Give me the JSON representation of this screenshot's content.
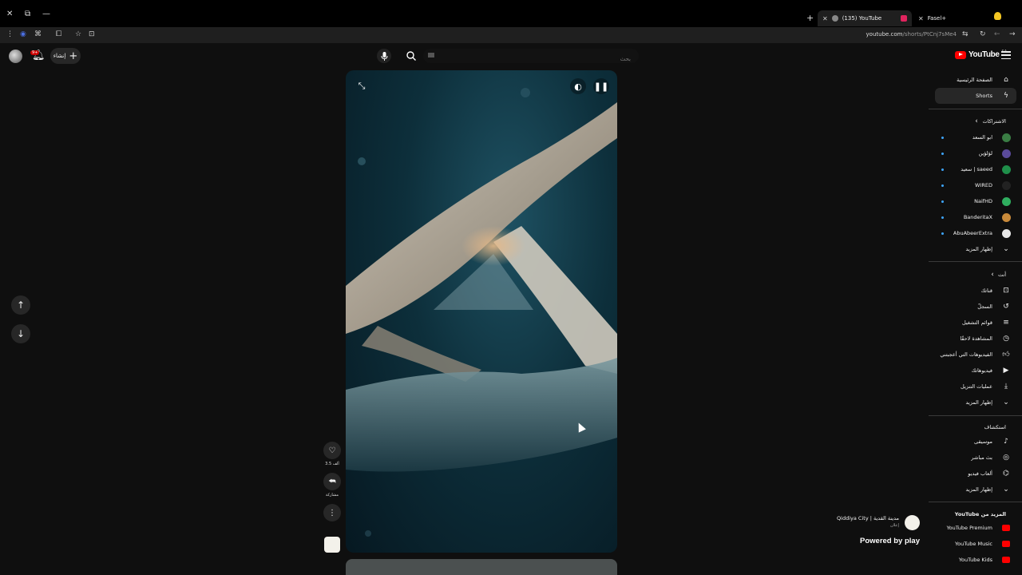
{
  "browser": {
    "tabs": [
      {
        "title": "(135) YouTube",
        "active": true
      },
      {
        "title": "Fasel+",
        "active": false
      }
    ],
    "url_host": "youtube.com",
    "url_path": "/shorts/PtCnj7sMe4"
  },
  "masthead": {
    "logo_text": "YouTube",
    "country_code": "SA",
    "search_placeholder": "بحث",
    "create_label": "إنشاء",
    "notification_count": "9+"
  },
  "short": {
    "likes_label": "3.5 ألف",
    "share_label": "مشاركة"
  },
  "sidebar": {
    "main": [
      {
        "label": "الصفحة الرئيسية",
        "icon": "home-icon"
      },
      {
        "label": "Shorts",
        "icon": "shorts-icon",
        "active": true
      }
    ],
    "subscriptions_title": "الاشتراكات",
    "subscriptions": [
      {
        "label": "ابو السعد",
        "color": "#3a7d44"
      },
      {
        "label": "لؤلؤين",
        "color": "#5a4a9a"
      },
      {
        "label": "saeed | سعيد",
        "color": "#1f8f4a"
      },
      {
        "label": "WIRED",
        "color": "#222222"
      },
      {
        "label": "NaifHD",
        "color": "#2fae5f"
      },
      {
        "label": "BanderitaX",
        "color": "#c98a3a"
      },
      {
        "label": "AbuAbeerExtra",
        "color": "#e8e8e8"
      }
    ],
    "subscriptions_more": "إظهار المزيد",
    "you_title": "أنت",
    "you": [
      {
        "label": "قناتك",
        "icon": "your-channel-icon"
      },
      {
        "label": "السجلّ",
        "icon": "history-icon"
      },
      {
        "label": "قوائم التشغيل",
        "icon": "playlists-icon"
      },
      {
        "label": "المشاهدة لاحقًا",
        "icon": "watch-later-icon"
      },
      {
        "label": "الفيديوهات التي أعجبتني",
        "icon": "liked-videos-icon"
      },
      {
        "label": "فيديوهاتك",
        "icon": "your-videos-icon"
      },
      {
        "label": "عمليات التنزيل",
        "icon": "downloads-icon"
      },
      {
        "label": "إظهار المزيد",
        "icon": "chevron-down-icon"
      }
    ],
    "explore_title": "استكشاف",
    "explore": [
      {
        "label": "موسيقى",
        "icon": "music-icon"
      },
      {
        "label": "بث مباشر",
        "icon": "live-icon"
      },
      {
        "label": "ألعاب فيديو",
        "icon": "gaming-icon"
      },
      {
        "label": "إظهار المزيد",
        "icon": "chevron-down-icon"
      }
    ],
    "more_title_prefix": "المزيد من",
    "more_title_brand": "YouTube",
    "more": [
      {
        "label": "YouTube Premium"
      },
      {
        "label": "YouTube Music"
      },
      {
        "label": "YouTube Kids"
      }
    ],
    "brand_color": "#ff0000"
  },
  "promo": {
    "channel_name": "Qiddiya City | مدينة القدية",
    "channel_sub": "إعلان",
    "powered_by": "Powered by play"
  }
}
